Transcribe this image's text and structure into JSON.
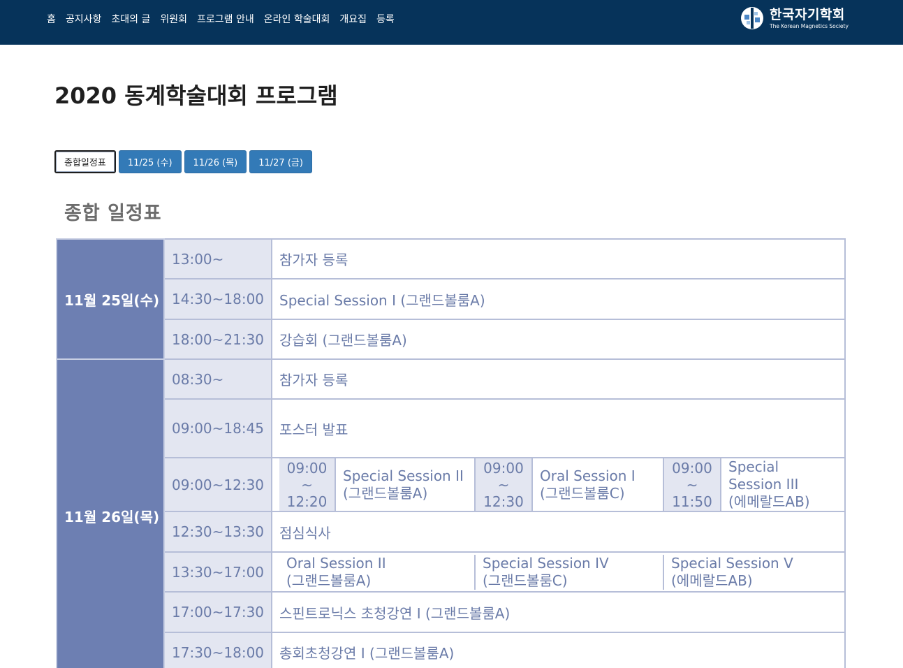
{
  "nav": {
    "items": [
      "홈",
      "공지사항",
      "초대의 글",
      "위원회",
      "프로그램 안내",
      "온라인 학술대회",
      "개요집",
      "등록"
    ]
  },
  "logo": {
    "name_ko": "한국자기학회",
    "name_en": "The Korean Magnetics Society"
  },
  "page_title": "2020 동계학술대회 프로그램",
  "tabs": [
    {
      "label": "종합일정표",
      "active": true
    },
    {
      "label": "11/25 (수)",
      "active": false
    },
    {
      "label": "11/26 (목)",
      "active": false
    },
    {
      "label": "11/27 (금)",
      "active": false
    }
  ],
  "section_title": "종합 일정표",
  "schedule": {
    "day1": {
      "date": "11월 25일(수)",
      "rows": [
        {
          "time": "13:00~",
          "event": "참가자 등록"
        },
        {
          "time": "14:30~18:00",
          "event": "Special Session I (그랜드볼룸A)"
        },
        {
          "time": "18:00~21:30",
          "event": "강습회 (그랜드볼룸A)"
        }
      ]
    },
    "day2": {
      "date": "11월 26일(목)",
      "rows": [
        {
          "time": "08:30~",
          "event": "참가자 등록"
        },
        {
          "time": "09:00~18:45",
          "event": "포스터 발표"
        },
        {
          "time": "09:00~12:30",
          "parallel": [
            {
              "start": "09:00",
              "sep": "~",
              "end": "12:20",
              "name": "Special Session II",
              "room": "(그랜드볼룸A)"
            },
            {
              "start": "09:00",
              "sep": "~",
              "end": "12:30",
              "name": "Oral Session I",
              "room": "(그랜드볼룸C)"
            },
            {
              "start": "09:00",
              "sep": "~",
              "end": "11:50",
              "name": "Special Session III",
              "room": "(에메랄드AB)"
            }
          ]
        },
        {
          "time": "12:30~13:30",
          "event": "점심식사"
        },
        {
          "time": "13:30~17:00",
          "parallel3": [
            {
              "name": "Oral Session II",
              "room": "(그랜드볼룸A)"
            },
            {
              "name": "Special Session IV",
              "room": "(그랜드볼룸C)"
            },
            {
              "name": "Special Session V",
              "room": "(에메랄드AB)"
            }
          ]
        },
        {
          "time": "17:00~17:30",
          "event": "스핀트로닉스 초청강연 I (그랜드볼룸A)"
        },
        {
          "time": "17:30~18:00",
          "event": "총회초청강연 I (그랜드볼룸A)"
        }
      ]
    }
  },
  "colors": {
    "topbar": "#06335a",
    "tab_blue": "#337ab7",
    "date_cell": "#6d7fb2",
    "time_cell": "#e3e6f1",
    "table_text": "#6a7ba8"
  }
}
